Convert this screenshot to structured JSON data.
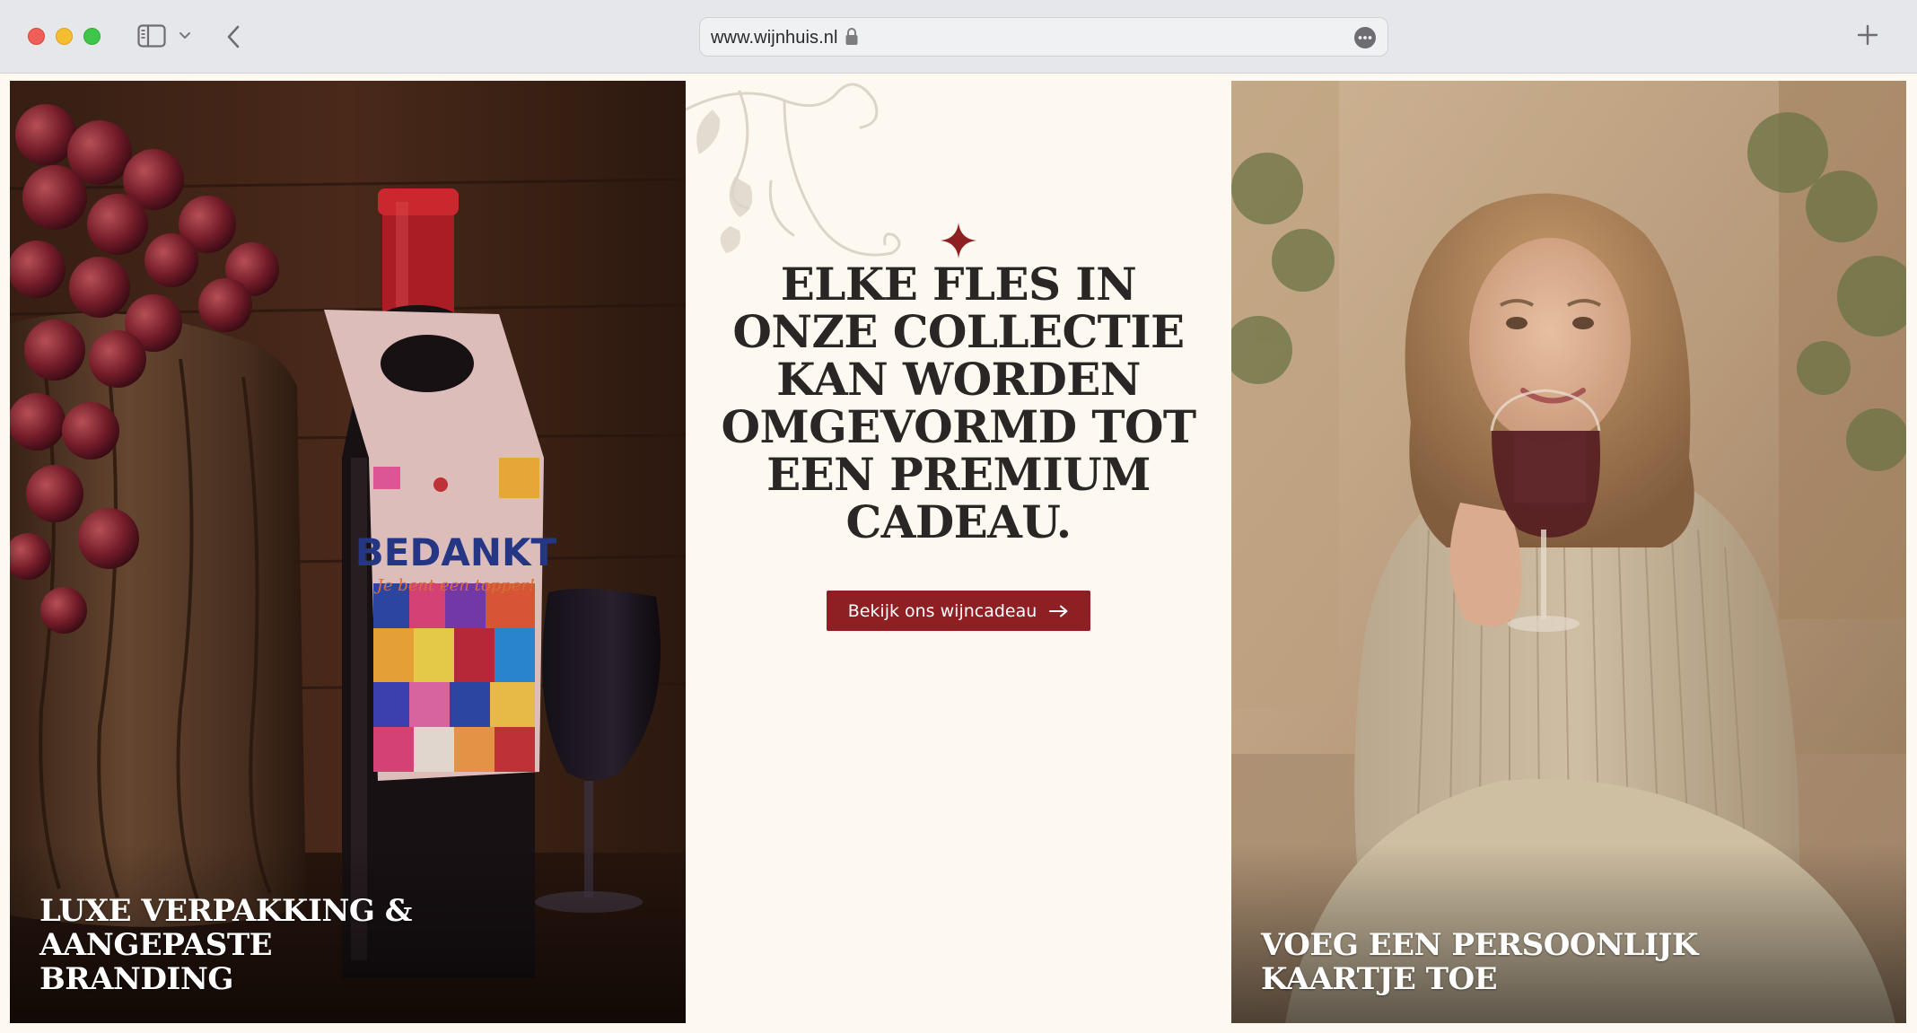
{
  "browser": {
    "url": "www.wijnhuis.nl"
  },
  "left_panel": {
    "caption": "LUXE VERPAKKING & AANGEPASTE BRANDING",
    "tag_title": "BEDANKT",
    "tag_subtitle": "Je bent een topper!"
  },
  "center": {
    "headline": "ELKE FLES IN ONZE COLLECTIE KAN WORDEN OMGEVORMD TOT EEN PREMIUM CADEAU.",
    "cta_label": "Bekijk ons wijncadeau"
  },
  "right_panel": {
    "caption": "VOEG EEN PERSOONLIJK KAARTJE TOE"
  },
  "colors": {
    "accent": "#8e1f23",
    "background": "#fdf9f0",
    "heading": "#2b2626"
  },
  "icons": [
    "sidebar-icon",
    "chevron-down-icon",
    "back-arrow-icon",
    "lock-icon",
    "more-options-icon",
    "plus-icon",
    "sparkle-icon",
    "arrow-right-icon"
  ]
}
